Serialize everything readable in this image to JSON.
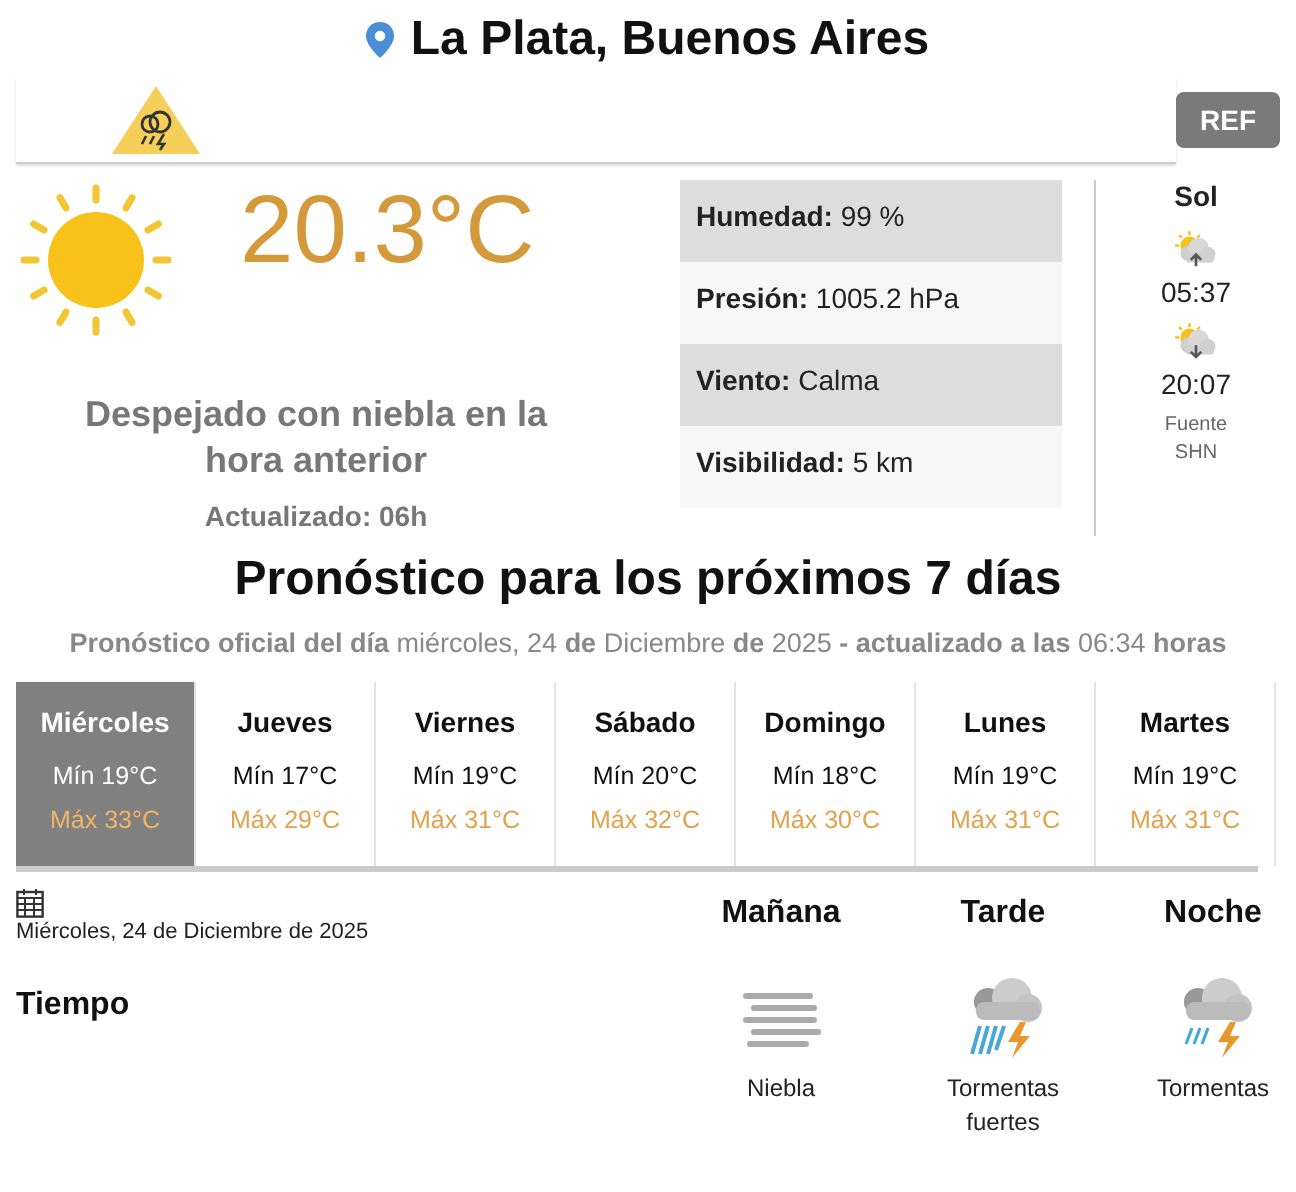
{
  "location": {
    "title": "La Plata, Buenos Aires"
  },
  "alert": {
    "button": "REF"
  },
  "current": {
    "temperature": "20.3°C",
    "description": "Despejado con niebla en la hora anterior",
    "updated": "Actualizado: 06h"
  },
  "stats": [
    {
      "text": "**Humedad:** 99 %"
    },
    {
      "text": "**Presión:** 1005.2 hPa"
    },
    {
      "text": "**Viento:** Calma"
    },
    {
      "text": "**Visibilidad:** 5 km"
    }
  ],
  "sun": {
    "title": "Sol",
    "sunrise": "05:37",
    "sunset": "20:07",
    "source": "Fuente SHN"
  },
  "forecast": {
    "title": "Pronóstico para los próximos 7 días",
    "subtitle": "**Pronóstico oficial del día** miércoles, 24 **de** Diciembre **de** 2025 **- actualizado a las** 06:34 **horas**",
    "days": [
      {
        "name": "Miércoles",
        "min": "Mín 19°C",
        "max": "Máx 33°C",
        "selected": true
      },
      {
        "name": "Jueves",
        "min": "Mín 17°C",
        "max": "Máx 29°C",
        "selected": false
      },
      {
        "name": "Viernes",
        "min": "Mín 19°C",
        "max": "Máx 31°C",
        "selected": false
      },
      {
        "name": "Sábado",
        "min": "Mín 20°C",
        "max": "Máx 32°C",
        "selected": false
      },
      {
        "name": "Domingo",
        "min": "Mín 18°C",
        "max": "Máx 30°C",
        "selected": false
      },
      {
        "name": "Lunes",
        "min": "Mín 19°C",
        "max": "Máx 31°C",
        "selected": false
      },
      {
        "name": "Martes",
        "min": "Mín 19°C",
        "max": "Máx 31°C",
        "selected": false
      }
    ]
  },
  "detail": {
    "date": "Miércoles, 24 de Diciembre de 2025",
    "row_label": "Tiempo",
    "periods": [
      {
        "name": "Mañana",
        "kind": "fog",
        "label": "Niebla"
      },
      {
        "name": "Tarde",
        "kind": "storm-strong",
        "label": "Tormentas fuertes"
      },
      {
        "name": "Noche",
        "kind": "storm",
        "label": "Tormentas"
      }
    ]
  }
}
